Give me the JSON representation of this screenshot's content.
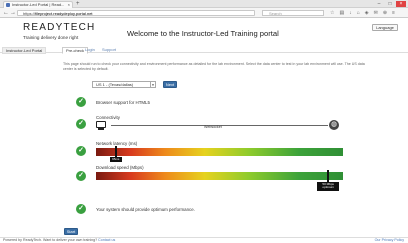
{
  "browser": {
    "tab_title": "Instructor-Led Portal | Read...",
    "url_prefix": "https://",
    "url_host": "fileproject.readydeploy.portal.net",
    "search_placeholder": "Search"
  },
  "brand": {
    "logo_text": "READYTECH",
    "tagline": "Training delivery done right"
  },
  "header": {
    "title": "Welcome to the Instructor-Led Training portal",
    "language": "Language"
  },
  "nav": {
    "tabs": [
      "Instructor-Led Portal",
      "Pre-check",
      "Login",
      "Support"
    ]
  },
  "intro": {
    "text": "This page should run to check your connectivity and environment performance as detailed for the lab environment. Select the data center to test in your lab environment will use. The US data center is selected by default."
  },
  "datacenter": {
    "selected": "US 1 - (Texas/dallas)",
    "next_label": "Next"
  },
  "checks": {
    "html5": "Browser support for HTML5",
    "connectivity": "Connectivity",
    "connectivity_status": "Websocket",
    "latency": "Network latency (ms)",
    "latency_value": "65ms",
    "download": "Download speed (Mbps)",
    "download_value": "50 Mbps optimum",
    "latency_fraction": 0.08,
    "download_fraction": 0.94,
    "result": "Your system should provide optimum performance."
  },
  "start_label": "Start",
  "footer": {
    "powered": "Powered by ReadyTech. Want to deliver your own training?",
    "contact": "Contact us",
    "privacy": "Our Privacy Policy"
  }
}
